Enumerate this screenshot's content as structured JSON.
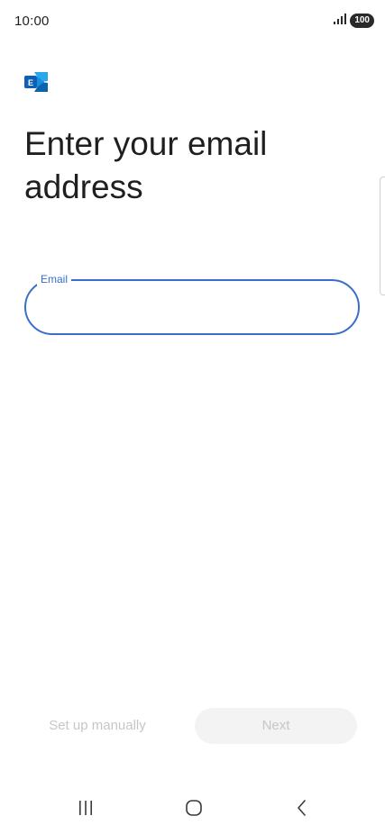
{
  "status_bar": {
    "time": "10:00",
    "battery": "100",
    "icons": [
      "signal-icon",
      "battery-icon"
    ]
  },
  "app": {
    "logo_icon": "exchange-logo-icon",
    "logo_letter": "E"
  },
  "title": "Enter your email address",
  "email_field": {
    "label": "Email",
    "value": "",
    "placeholder": ""
  },
  "actions": {
    "setup_manually": "Set up manually",
    "next": "Next"
  },
  "nav_bar": {
    "icons": [
      "recents-icon",
      "home-icon",
      "back-icon"
    ]
  },
  "colors": {
    "accent": "#3a6fc9",
    "disabled_text": "#c6c6c6",
    "disabled_button_bg": "#f3f3f3"
  }
}
